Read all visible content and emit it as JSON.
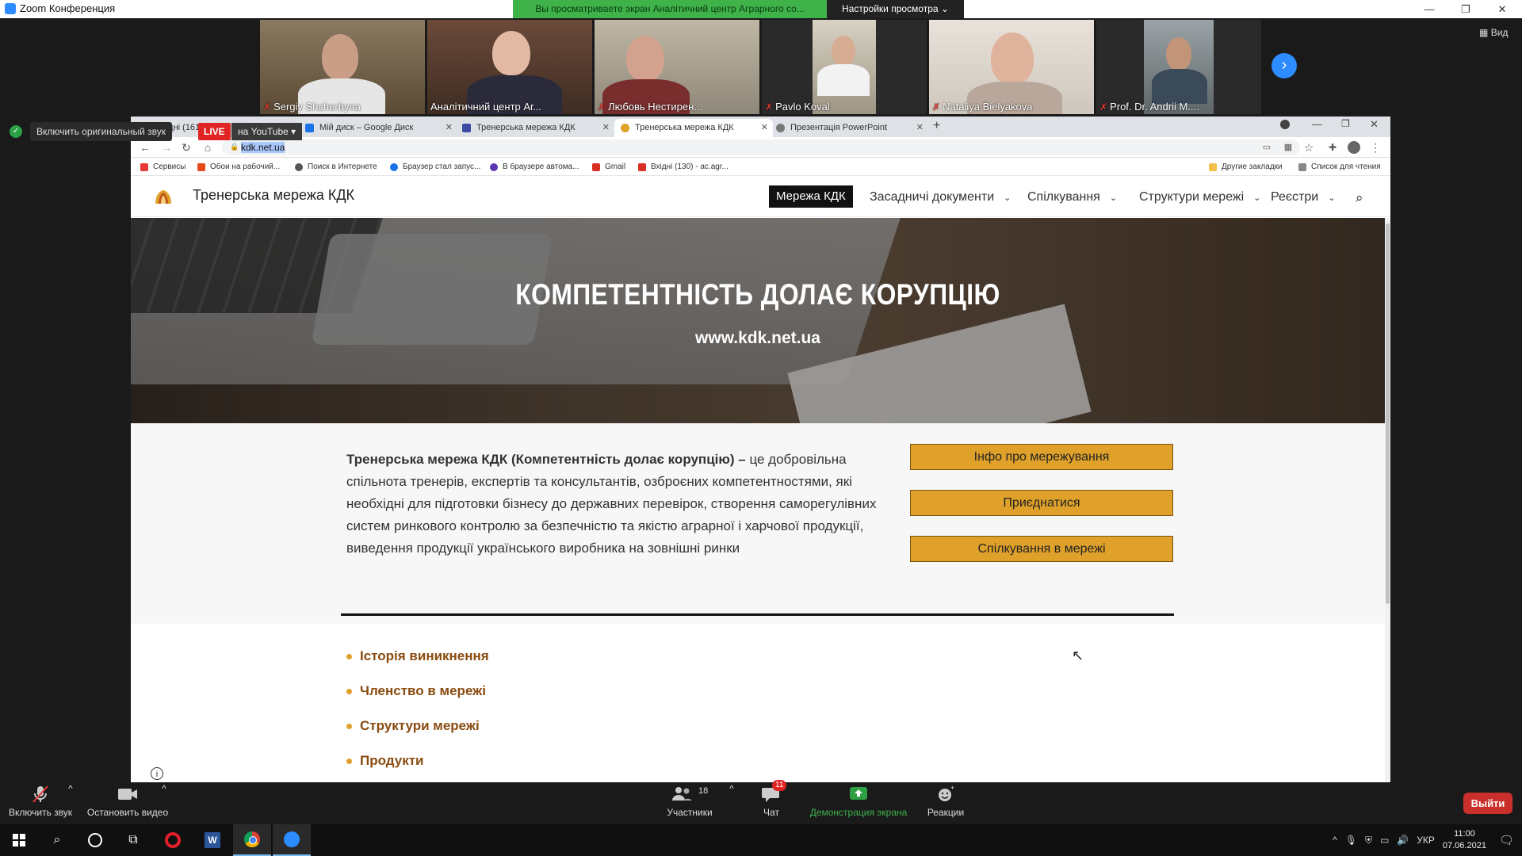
{
  "zoom": {
    "window_title": "Zoom Конференция",
    "share_banner": "Вы просматриваете экран Аналітичний центр Аграрного со...",
    "view_options": "Настройки просмотра",
    "view_button": "Вид",
    "original_sound": "Включить оригинальный звук",
    "live_badge": "LIVE",
    "live_target": "на YouTube",
    "participants": [
      {
        "name": "Sergiy Shcherbyna"
      },
      {
        "name": "Аналітичний центр Аг..."
      },
      {
        "name": "Любовь Нестирен..."
      },
      {
        "name": "Pavlo Koval"
      },
      {
        "name": "Nataliya Bielyakova"
      },
      {
        "name": "Prof. Dr. Andrii M...."
      }
    ],
    "toolbar": {
      "unmute": "Включить звук",
      "start_video": "Остановить видео",
      "participants_label": "Участники",
      "participants_count": "18",
      "chat": "Чат",
      "chat_badge": "11",
      "share_screen": "Демонстрация экрана",
      "reactions": "Реакции",
      "leave": "Выйти"
    }
  },
  "browser": {
    "tabs": [
      {
        "title": "Вхідні (161)",
        "color": "#d93025"
      },
      {
        "title": "Мій диск – Google Диск",
        "color": "#1a73e8"
      },
      {
        "title": "Тренерська мережа КДК",
        "color": "#3c4aa5"
      },
      {
        "title": "Тренерська мережа КДК",
        "color": "#e0a12a"
      },
      {
        "title": "Презентація PowerPoint",
        "color": "#777777"
      }
    ],
    "url": "kdk.net.ua",
    "bookmarks": [
      "Сервисы",
      "Обои на рабочий...",
      "Поиск в Интернете",
      "Браузер стал запус...",
      "В браузере автома...",
      "Gmail",
      "Вхідні (130) - ac.agr..."
    ],
    "bookmarks_right": [
      "Другие закладки",
      "Список для чтения"
    ]
  },
  "site": {
    "title": "Тренерська мережа КДК",
    "nav": {
      "home": "Мережа КДК",
      "items": [
        "Засадничі документи",
        "Спілкування",
        "Структури мережі",
        "Реєстри"
      ]
    },
    "hero_title": "КОМПЕТЕНТНІСТЬ ДОЛАЄ КОРУПЦІЮ",
    "hero_url": "www.kdk.net.ua",
    "intro_bold": "Тренерська мережа КДК (Компетентність долає корупцію) –",
    "intro_text": " це добровільна спільнота тренерів, експертів та консультантів, озброєних компетентностями, які необхідні для підготовки бізнесу до державних перевірок, створення саморегулівних систем ринкового контролю за безпечністю та якістю аграрної і харчової продукції, виведення продукції українського виробника на зовнішні ринки",
    "buttons": [
      "Інфо про мережування",
      "Приєднатися",
      "Спілкування в мережі"
    ],
    "links": [
      "Історія виникнення",
      "Членство в мережі",
      "Структури мережі",
      "Продукти"
    ]
  },
  "taskbar": {
    "language": "УКР",
    "time": "11:00",
    "date": "07.06.2021"
  },
  "colors": {
    "accent": "#e0a12a",
    "zoom_blue": "#2d8cff",
    "share_green": "#3fb24a",
    "leave_red": "#c9302c"
  }
}
